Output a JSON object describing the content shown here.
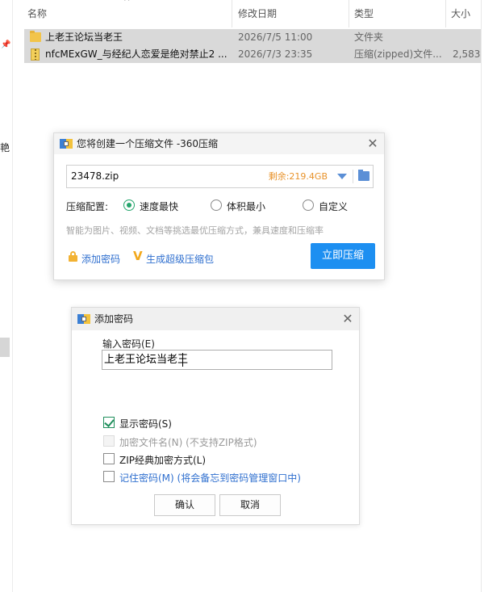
{
  "explorer": {
    "columns": {
      "name": "名称",
      "modified": "修改日期",
      "type": "类型",
      "size": "大小"
    },
    "sort_arrow": "^",
    "left_cut_text": "艳",
    "rows": [
      {
        "name": "上老王论坛当老王",
        "modified": "2026/7/5 11:00",
        "type": "文件夹",
        "size": "",
        "icon": "folder-icon"
      },
      {
        "name": "nfcMExGW_与经纪人恋爱是绝对禁止2 ...",
        "modified": "2026/7/3 23:35",
        "type": "压缩(zipped)文件...",
        "size": "2,583,",
        "icon": "zip-file-icon"
      }
    ]
  },
  "compress_dialog": {
    "title": "您将创建一个压缩文件 -360压缩",
    "close_glyph": "✕",
    "path_value": "23478.zip",
    "free_space": "剩余:219.4GB",
    "config_label": "压缩配置:",
    "options": [
      {
        "label": "速度最快",
        "selected": true
      },
      {
        "label": "体积最小",
        "selected": false
      },
      {
        "label": "自定义",
        "selected": false
      }
    ],
    "hint": "智能为图片、视频、文档等挑选最优压缩方式，兼具速度和压缩率",
    "add_password_label": "添加密码",
    "super_package_label": "生成超级压缩包",
    "compress_now_label": "立即压缩"
  },
  "password_dialog": {
    "title": "添加密码",
    "close_glyph": "✕",
    "input_label": "输入密码(E)",
    "input_value": "上老王论坛当老王",
    "checkboxes": [
      {
        "label": "显示密码(S)",
        "checked": true,
        "disabled": false
      },
      {
        "label": "加密文件名(N) (不支持ZIP格式)",
        "checked": false,
        "disabled": true
      },
      {
        "label": "ZIP经典加密方式(L)",
        "checked": false,
        "disabled": false
      },
      {
        "label": "记住密码(M) (将会备忘到密码管理窗口中)",
        "checked": false,
        "disabled": false
      }
    ],
    "ok_label": "确认",
    "cancel_label": "取消"
  },
  "colors": {
    "accent": "#1d8ff1",
    "radio_on": "#25a56c",
    "free_space": "#e8922a",
    "link": "#2f6fcf",
    "selection_row": "#d9d9d9"
  }
}
